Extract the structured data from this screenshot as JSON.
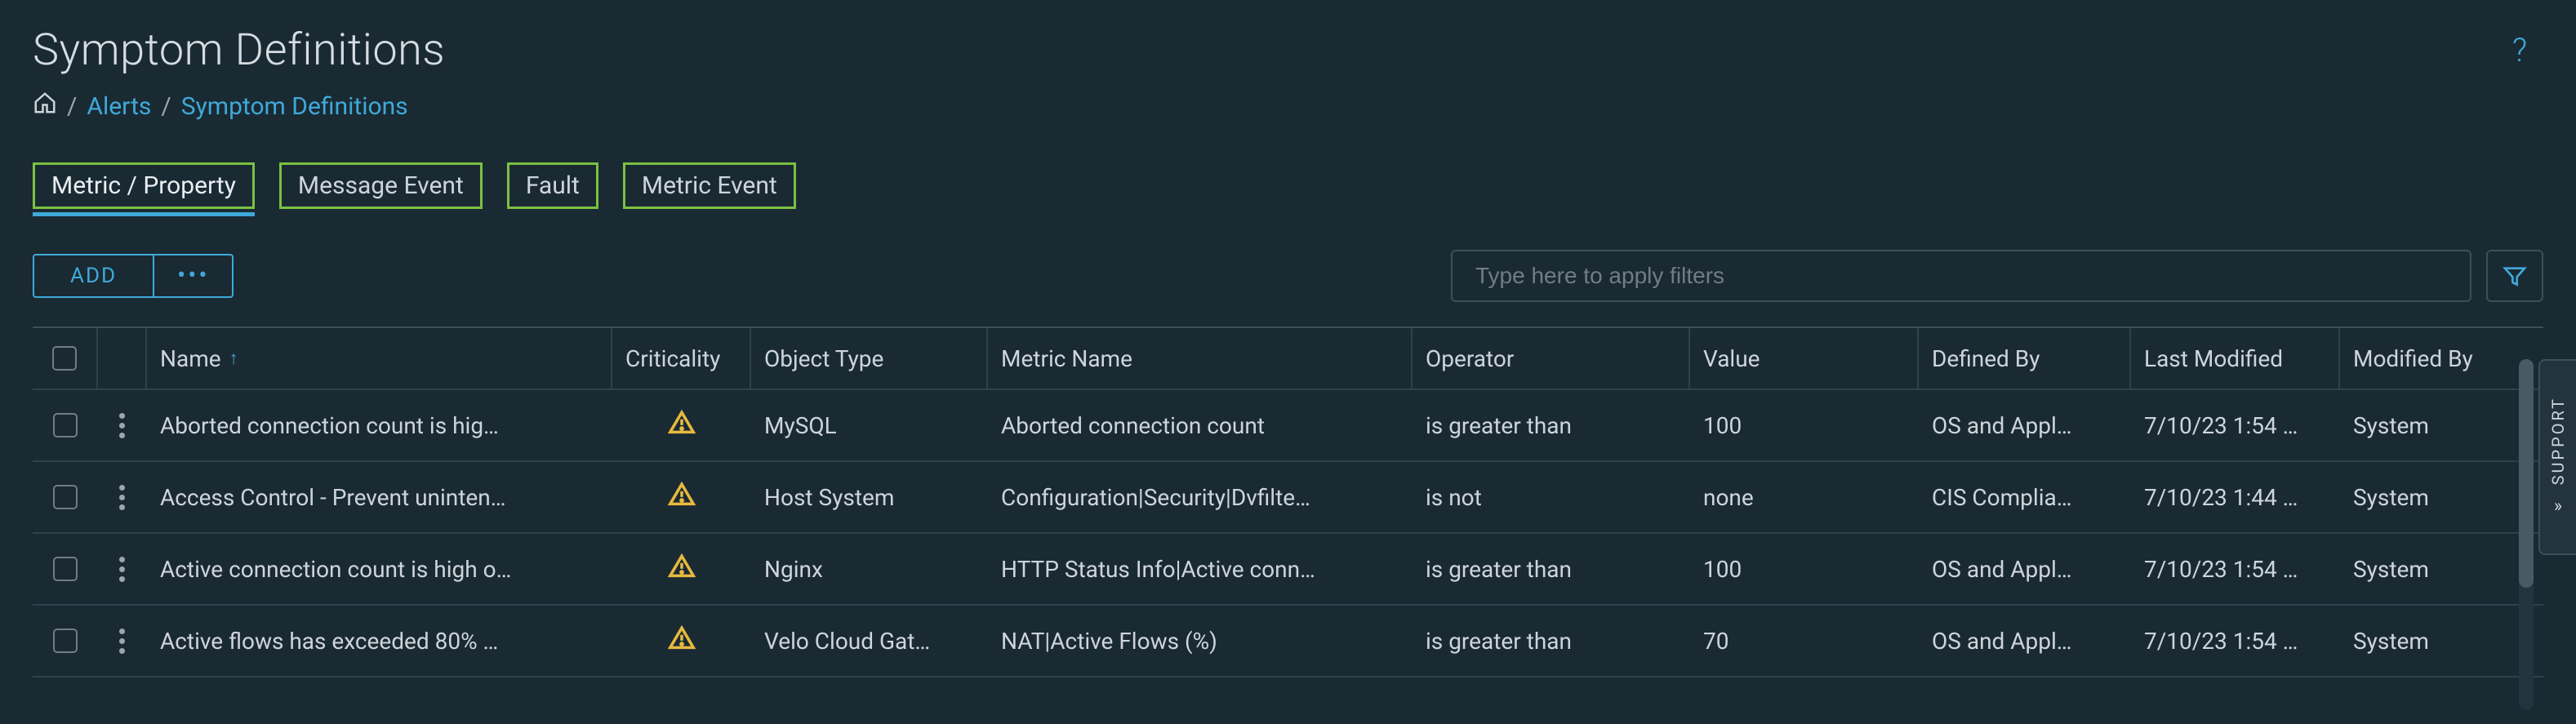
{
  "page": {
    "title": "Symptom Definitions"
  },
  "breadcrumb": {
    "alerts": "Alerts",
    "current": "Symptom Definitions"
  },
  "tabs": {
    "metric_property": "Metric / Property",
    "message_event": "Message Event",
    "fault": "Fault",
    "metric_event": "Metric Event"
  },
  "toolbar": {
    "add_label": "ADD",
    "more_label": "•••"
  },
  "filter": {
    "placeholder": "Type here to apply filters"
  },
  "support": {
    "label": "SUPPORT"
  },
  "table": {
    "headers": {
      "name": "Name",
      "criticality": "Criticality",
      "object_type": "Object Type",
      "metric_name": "Metric Name",
      "operator": "Operator",
      "value": "Value",
      "defined_by": "Defined By",
      "last_modified": "Last Modified",
      "modified_by": "Modified By"
    },
    "sort": {
      "column": "name",
      "dir": "asc"
    },
    "rows": [
      {
        "name": "Aborted connection count is hig…",
        "criticality": "warning",
        "object_type": "MySQL",
        "metric_name": "Aborted connection count",
        "operator": "is greater than",
        "value": "100",
        "defined_by": "OS and Appl…",
        "last_modified": "7/10/23 1:54 …",
        "modified_by": "System"
      },
      {
        "name": "Access Control - Prevent uninten…",
        "criticality": "warning",
        "object_type": "Host System",
        "metric_name": "Configuration|Security|Dvfilte…",
        "operator": "is not",
        "value": "none",
        "defined_by": "CIS Complia…",
        "last_modified": "7/10/23 1:44 …",
        "modified_by": "System"
      },
      {
        "name": "Active connection count is high o…",
        "criticality": "warning",
        "object_type": "Nginx",
        "metric_name": "HTTP Status Info|Active conn…",
        "operator": "is greater than",
        "value": "100",
        "defined_by": "OS and Appl…",
        "last_modified": "7/10/23 1:54 …",
        "modified_by": "System"
      },
      {
        "name": "Active flows has exceeded 80% …",
        "criticality": "warning",
        "object_type": "Velo Cloud Gat…",
        "metric_name": "NAT|Active Flows (%)",
        "operator": "is greater than",
        "value": "70",
        "defined_by": "OS and Appl…",
        "last_modified": "7/10/23 1:54 …",
        "modified_by": "System"
      }
    ]
  }
}
